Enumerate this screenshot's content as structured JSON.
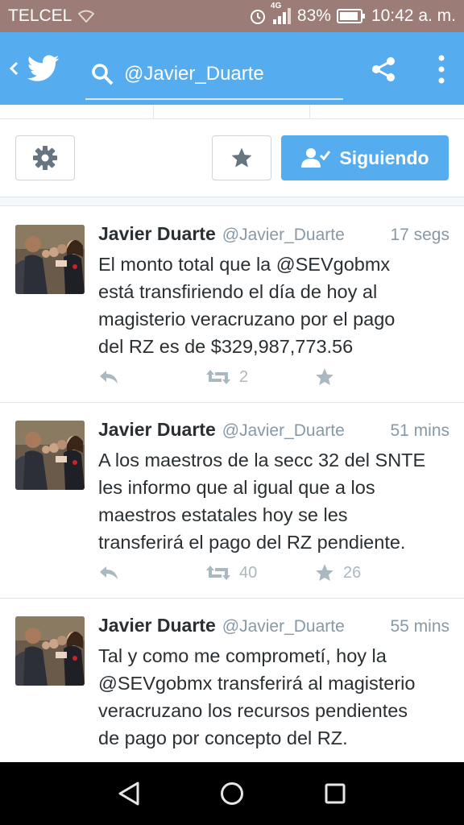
{
  "status_bar": {
    "carrier": "TELCEL",
    "network_type": "4G",
    "battery_percent": "83%",
    "time": "10:42 a. m."
  },
  "app_bar": {
    "search_query": "@Javier_Duarte"
  },
  "profile_actions": {
    "follow_label": "Siguiendo"
  },
  "tweets": [
    {
      "name": "Javier Duarte",
      "handle": "@Javier_Duarte",
      "time": "17 segs",
      "lines": [
        "El monto total que la @SEVgobmx",
        "está transfiriendo el día de hoy al",
        "magisterio veracruzano por el pago",
        "del RZ es de $329,987,773.56"
      ],
      "retweets": "2",
      "favorites": ""
    },
    {
      "name": "Javier Duarte",
      "handle": "@Javier_Duarte",
      "time": "51 mins",
      "lines": [
        "A los maestros de la secc 32 del SNTE",
        "les informo que al igual que a los",
        "maestros estatales hoy se les",
        "transferirá el pago del RZ pendiente."
      ],
      "retweets": "40",
      "favorites": "26"
    },
    {
      "name": "Javier Duarte",
      "handle": "@Javier_Duarte",
      "time": "55 mins",
      "lines": [
        "Tal y como me comprometí, hoy la",
        "@SEVgobmx transferirá al magisterio",
        "veracruzano los recursos pendientes",
        "de pago por concepto del RZ."
      ],
      "retweets": "",
      "favorites": ""
    }
  ],
  "colors": {
    "status_bar": "#9b7c77",
    "twitter_blue": "#55acee",
    "text": "#292f33",
    "muted": "#8899a6",
    "icon_gray": "#aab8c2"
  },
  "icons": {
    "back": "chevron-left-icon",
    "logo": "twitter-bird-icon",
    "search": "search-icon",
    "share": "share-icon",
    "menu": "more-vertical-icon",
    "settings": "gear-icon",
    "favorite": "star-icon",
    "following": "user-check-icon",
    "reply": "reply-icon",
    "retweet": "retweet-icon",
    "nav_back": "triangle-back-icon",
    "nav_home": "circle-home-icon",
    "nav_recents": "square-recents-icon"
  }
}
